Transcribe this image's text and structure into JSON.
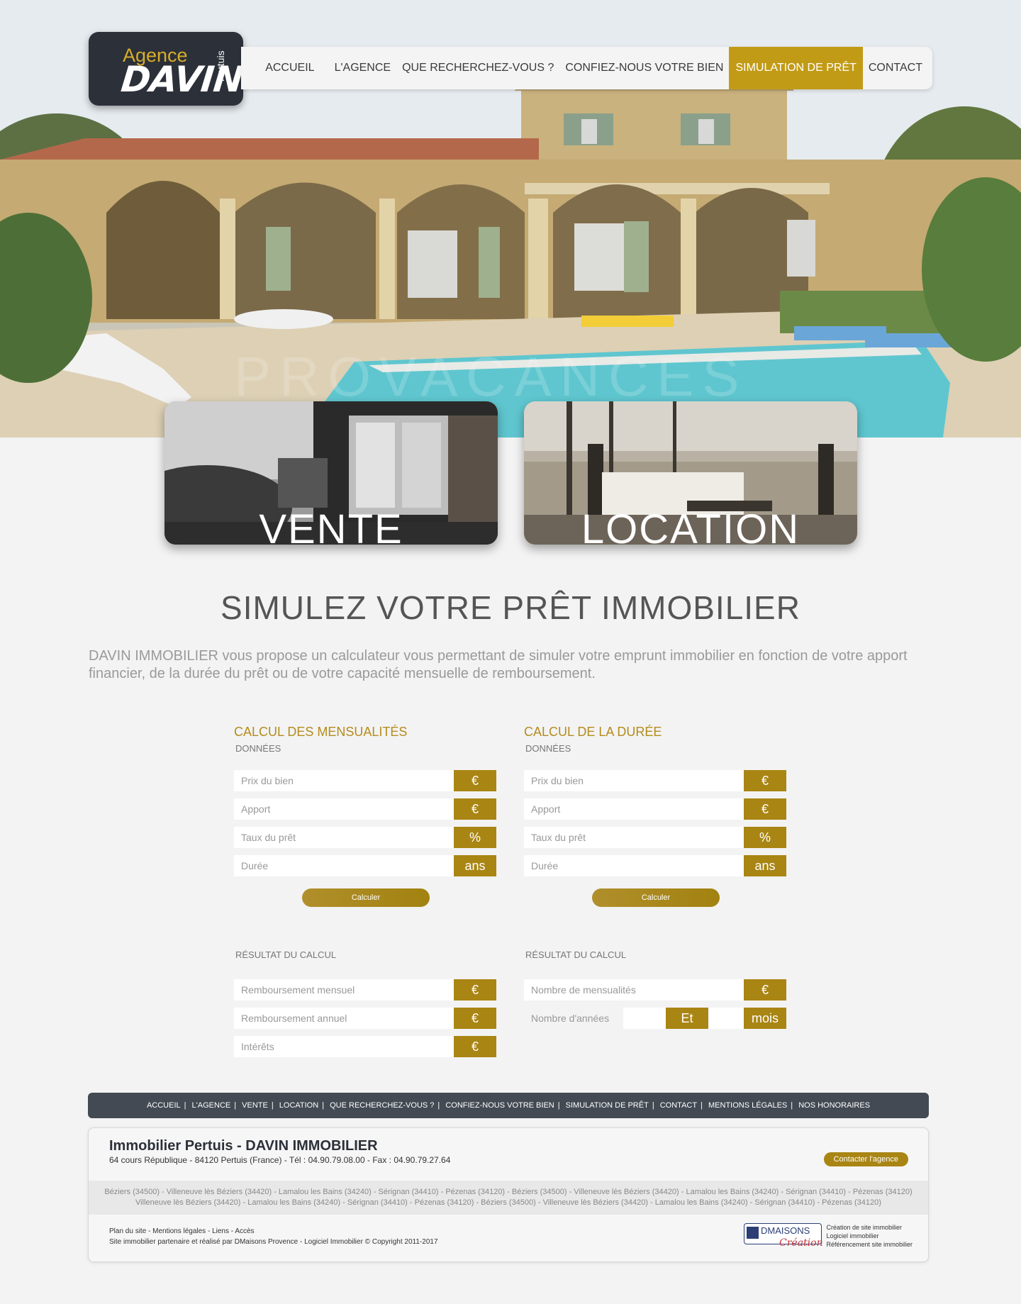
{
  "header": {
    "logo": {
      "line1": "Agence",
      "line2": "DAVIN",
      "line3": "Pertuis"
    },
    "nav": [
      {
        "label": "ACCUEIL"
      },
      {
        "label": "L'AGENCE"
      },
      {
        "label": "QUE RECHERCHEZ-VOUS ?"
      },
      {
        "label": "CONFIEZ-NOUS VOTRE BIEN"
      },
      {
        "label": "SIMULATION DE PRÊT",
        "active": true
      },
      {
        "label": "CONTACT"
      }
    ]
  },
  "hero": {
    "watermark": "PROVACANCES"
  },
  "cards": {
    "vente": "VENTE",
    "location": "LOCATION"
  },
  "main": {
    "title": "SIMULEZ VOTRE PRÊT IMMOBILIER",
    "intro": "DAVIN IMMOBILIER vous propose un calculateur vous permettant de simuler votre emprunt immobilier en fonction de votre apport financier, de la durée du prêt ou de votre capacité mensuelle de remboursement."
  },
  "calc_mensualites": {
    "title": "CALCUL DES MENSUALITÉS",
    "data_label": "DONNÉES",
    "fields": [
      {
        "placeholder": "Prix du bien",
        "unit": "€"
      },
      {
        "placeholder": "Apport",
        "unit": "€"
      },
      {
        "placeholder": "Taux du prêt",
        "unit": "%"
      },
      {
        "placeholder": "Durée",
        "unit": "ans"
      }
    ],
    "button": "Calculer",
    "result_label": "RÉSULTAT DU CALCUL",
    "results": [
      {
        "placeholder": "Remboursement mensuel",
        "unit": "€"
      },
      {
        "placeholder": "Remboursement annuel",
        "unit": "€"
      },
      {
        "placeholder": "Intérêts",
        "unit": "€"
      }
    ]
  },
  "calc_duree": {
    "title": "CALCUL DE LA DURÉE",
    "data_label": "DONNÉES",
    "fields": [
      {
        "placeholder": "Prix du bien",
        "unit": "€"
      },
      {
        "placeholder": "Apport",
        "unit": "€"
      },
      {
        "placeholder": "Taux du prêt",
        "unit": "%"
      },
      {
        "placeholder": "Durée",
        "unit": "ans"
      }
    ],
    "button": "Calculer",
    "result_label": "RÉSULTAT DU CALCUL",
    "results": [
      {
        "placeholder": "Nombre de mensualités",
        "unit": "€"
      }
    ],
    "years_row": {
      "label": "Nombre d'années",
      "mid_unit": "Et",
      "unit": "mois"
    }
  },
  "footer": {
    "nav": [
      "ACCUEIL",
      "L'AGENCE",
      "VENTE",
      "LOCATION",
      "QUE RECHERCHEZ-VOUS ?",
      "CONFIEZ-NOUS VOTRE BIEN",
      "SIMULATION DE PRÊT",
      "CONTACT",
      "MENTIONS LÉGALES",
      "NOS HONORAIRES"
    ],
    "company": "Immobilier Pertuis - DAVIN IMMOBILIER",
    "address": "64 cours République - 84120 Pertuis (France) - Tél : 04.90.79.08.00 - Fax : 04.90.79.27.64",
    "contact_button": "Contacter l'agence",
    "cities_line1": "Béziers (34500) - Villeneuve lès Béziers (34420) - Lamalou les Bains (34240) - Sérignan (34410) - Pézenas (34120) - Béziers (34500) - Villeneuve lès Béziers (34420) - Lamalou les Bains (34240) - Sérignan (34410) - Pézenas (34120)",
    "cities_line2": "Villeneuve lès Béziers (34420) - Lamalou les Bains (34240) - Sérignan (34410) - Pézenas (34120) - Béziers (34500) - Villeneuve lès Béziers (34420) - Lamalou les Bains (34240) - Sérignan (34410) - Pézenas (34120)",
    "links": "Plan du site - Mentions légales - Liens - Accès",
    "credits": "Site immobilier partenaire et réalisé par DMaisons Provence - Logiciel Immobilier © Copyright 2011-2017",
    "dmaisons": {
      "name": "DMAISONS",
      "script": "Création"
    },
    "dmaisons_text": [
      "Création de site immobilier",
      "Logiciel immobilier",
      "Référencement site immobilier"
    ]
  }
}
